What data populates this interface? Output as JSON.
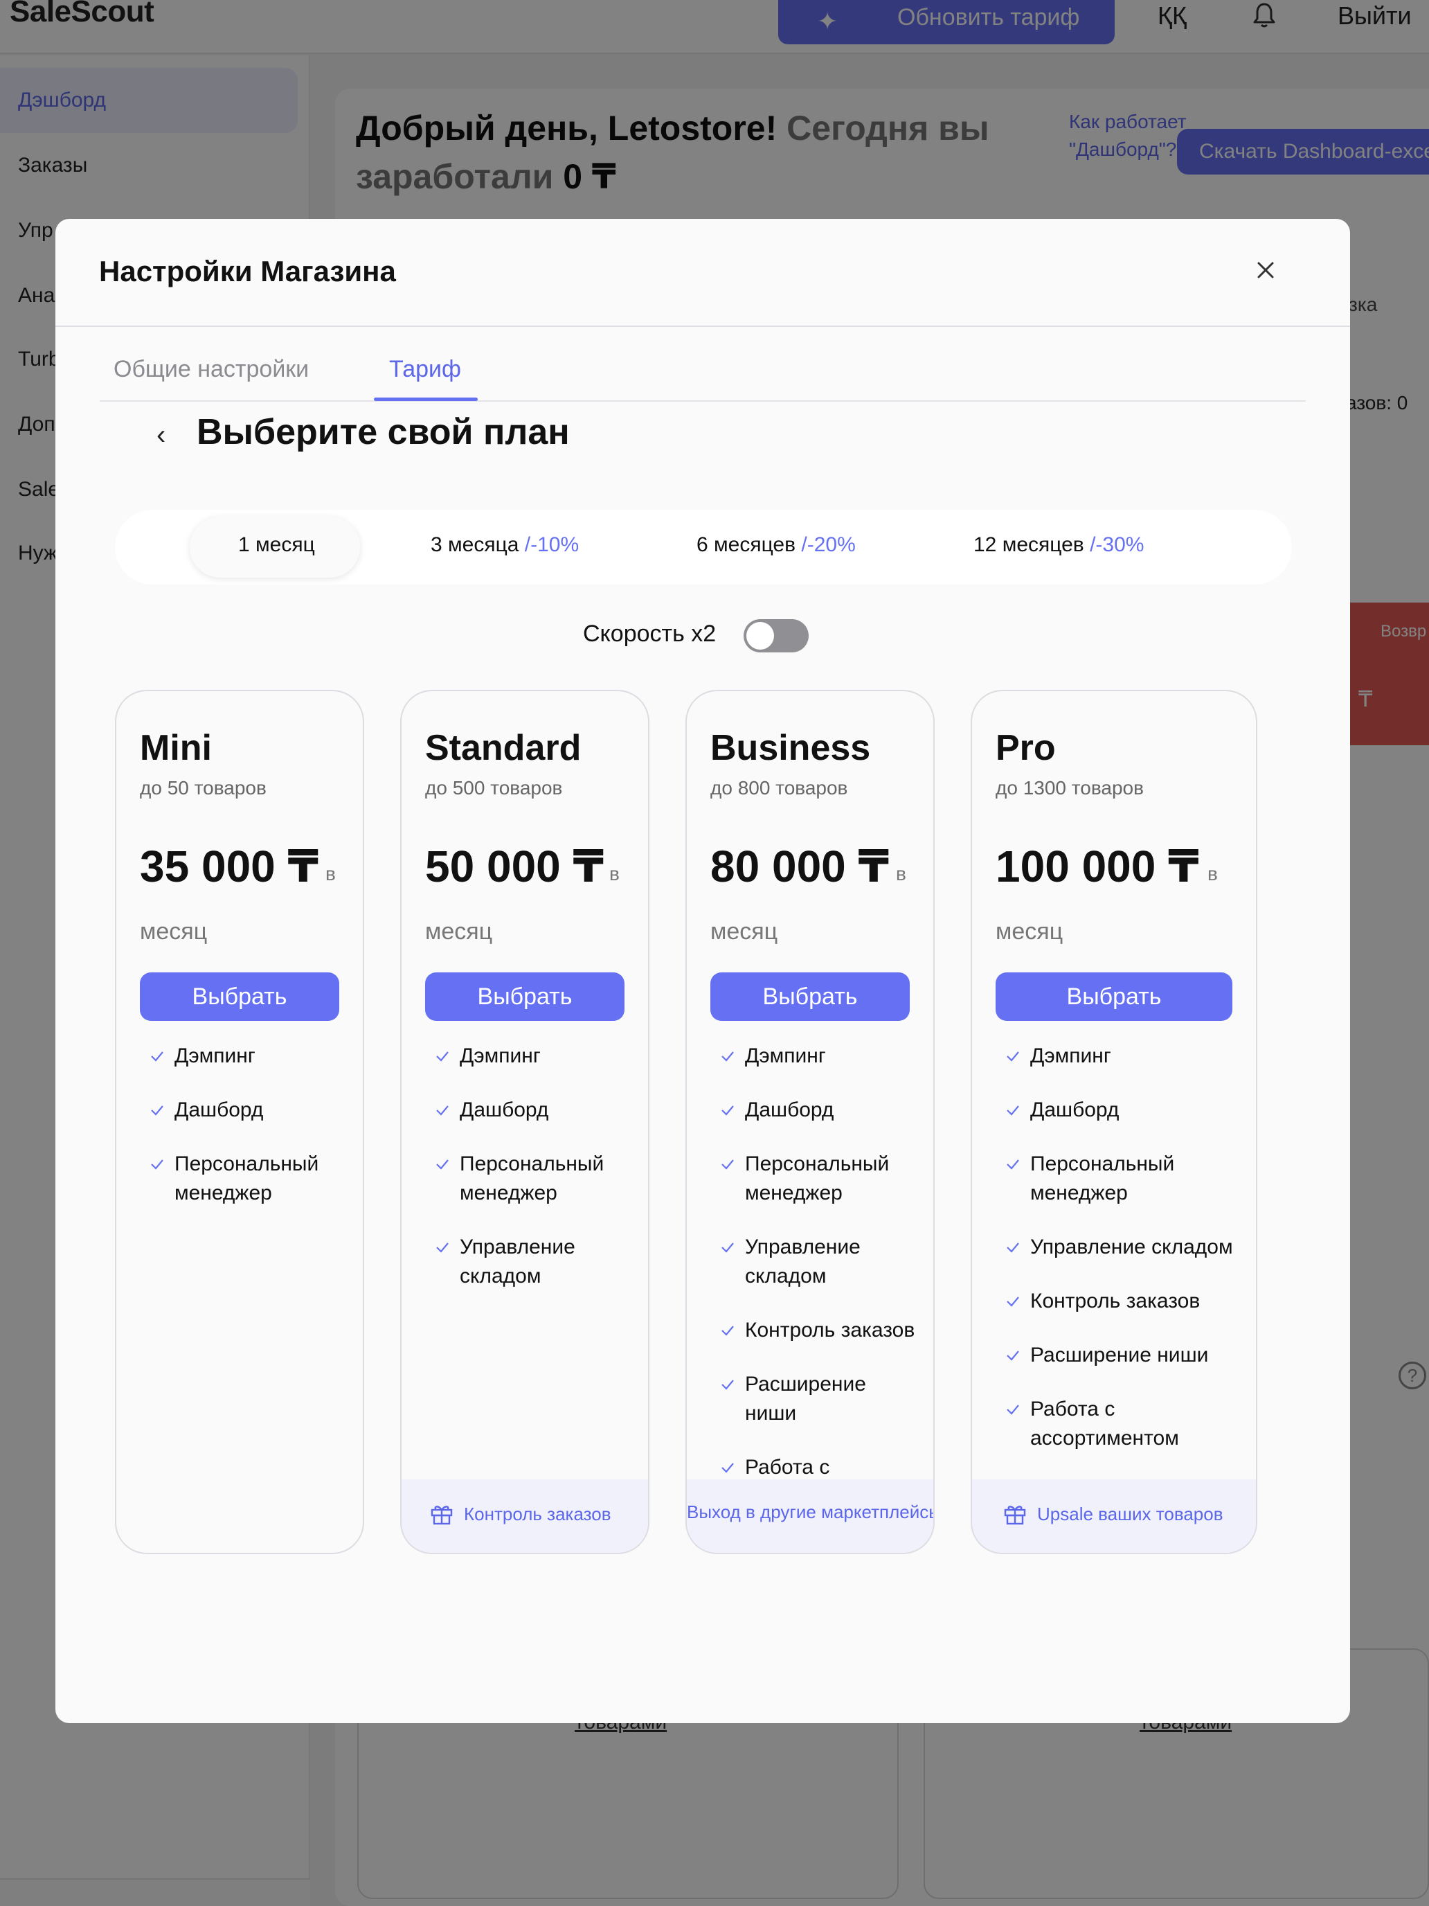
{
  "app": {
    "logo": "SaleScout",
    "upgrade_button": "Обновить тариф",
    "language": "ҚҚ",
    "logout": "Выйти"
  },
  "sidebar": {
    "items": [
      {
        "label": "Дэшборд",
        "active": true
      },
      {
        "label": "Заказы"
      },
      {
        "label": "Упр"
      },
      {
        "label": "Ана"
      },
      {
        "label": "Turb"
      },
      {
        "label": "Доп"
      },
      {
        "label": "Sale"
      },
      {
        "label": "Нуж"
      }
    ]
  },
  "dashboard": {
    "greeting": "Добрый день, Letostore!",
    "earned_prefix": "Сегодня вы заработали",
    "earned_amount": "0 ₸",
    "how_it_works": "Как работает \"Дашборд\"?",
    "download_button": "Скачать Dashboard-excel",
    "right_label_1": "зка",
    "right_label_2": "азов: 0",
    "red_card_title": "Возвр",
    "red_card_value": "₸",
    "link_1": "товарами",
    "link_2": "товарами"
  },
  "modal": {
    "title": "Настройки Магазина",
    "tabs": [
      {
        "label": "Общие настройки",
        "active": false
      },
      {
        "label": "Тариф",
        "active": true
      }
    ],
    "plan_heading": "Выберите свой план",
    "periods": [
      {
        "label": "1 месяц",
        "discount": "",
        "active": true
      },
      {
        "label": "3 месяца",
        "discount": "/-10%"
      },
      {
        "label": "6 месяцев",
        "discount": "/-20%"
      },
      {
        "label": "12 месяцев",
        "discount": "/-30%"
      }
    ],
    "speed_label": "Скорость x2",
    "speed_enabled": false,
    "plans": [
      {
        "name": "Mini",
        "limit": "до 50 товаров",
        "price": "35 000 ₸",
        "per_short": "в",
        "per_long": "месяц",
        "button": "Выбрать",
        "features": [
          "Дэмпинг",
          "Дашборд",
          "Персональный менеджер"
        ],
        "bonus": ""
      },
      {
        "name": "Standard",
        "limit": "до 500 товаров",
        "price": "50 000 ₸",
        "per_short": "в",
        "per_long": "месяц",
        "button": "Выбрать",
        "features": [
          "Дэмпинг",
          "Дашборд",
          "Персональный менеджер",
          "Управление складом"
        ],
        "bonus": "Контроль заказов"
      },
      {
        "name": "Business",
        "limit": "до 800 товаров",
        "price": "80 000 ₸",
        "per_short": "в",
        "per_long": "месяц",
        "button": "Выбрать",
        "features": [
          "Дэмпинг",
          "Дашборд",
          "Персональный менеджер",
          "Управление складом",
          "Контроль заказов",
          "Расширение ниши",
          "Работа с ассортиментом"
        ],
        "bonus": "Выход в другие маркетплейсы"
      },
      {
        "name": "Pro",
        "limit": "до 1300 товаров",
        "price": "100 000 ₸",
        "per_short": "в",
        "per_long": "месяц",
        "button": "Выбрать",
        "features": [
          "Дэмпинг",
          "Дашборд",
          "Персональный менеджер",
          "Управление складом",
          "Контроль заказов",
          "Расширение ниши",
          "Работа с ассортиментом"
        ],
        "bonus": "Upsale ваших товаров"
      }
    ]
  },
  "colors": {
    "accent": "#6571f2",
    "danger": "#e25a55",
    "overlay": "rgba(0,0,0,0.49)"
  }
}
